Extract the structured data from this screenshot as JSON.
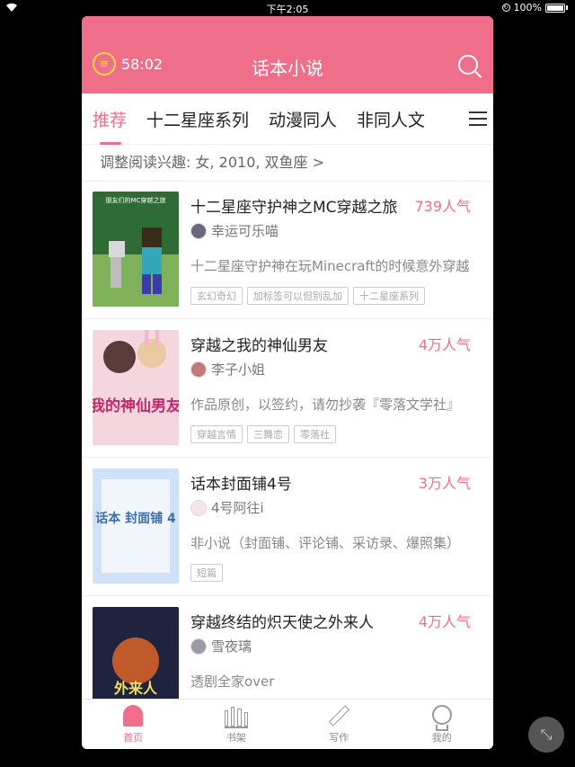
{
  "status_bar": {
    "time": "下午2:05",
    "battery": "100%"
  },
  "header": {
    "timer": "58:02",
    "title": "话本小说"
  },
  "tabs": [
    "推荐",
    "十二星座系列",
    "动漫同人",
    "非同人文"
  ],
  "interest": "调整阅读兴趣: 女, 2010, 双鱼座 >",
  "books": [
    {
      "title": "十二星座守护神之MC穿越之旅",
      "popularity": "739人气",
      "author": "幸运可乐喵",
      "desc": "十二星座守护神在玩Minecraft的时候意外穿越",
      "tags": [
        "玄幻奇幻",
        "加标签可以但别乱加",
        "十二星座系列"
      ],
      "cover_text": "朋友们的MC穿越之旅",
      "cover_colors": [
        "#2f6b35",
        "#7fb05a"
      ]
    },
    {
      "title": "穿越之我的神仙男友",
      "popularity": "4万人气",
      "author": "李子小姐",
      "desc": "作品原创，以签约，请勿抄袭『零落文学社』",
      "tags": [
        "穿越言情",
        "三舞恋",
        "零落社"
      ],
      "cover_text": "我的神仙男友",
      "cover_colors": [
        "#f5d6df",
        "#c2688a"
      ]
    },
    {
      "title": "话本封面铺4号",
      "popularity": "3万人气",
      "author": "4号阿往i",
      "desc": "非小说（封面铺、评论铺、采访录、爆照集）",
      "tags": [
        "短篇"
      ],
      "cover_text": "话本 封面铺 4",
      "cover_colors": [
        "#cfe2f7",
        "#3d6fae"
      ]
    },
    {
      "title": "穿越终结的炽天使之外来人",
      "popularity": "4万人气",
      "author": "雪夜璃",
      "desc": "透剧全家over",
      "tags": [],
      "cover_text": "外来人",
      "cover_colors": [
        "#1f2340",
        "#c05a2a"
      ]
    }
  ],
  "tabbar": [
    {
      "label": "首页",
      "icon": "home-icon"
    },
    {
      "label": "书架",
      "icon": "bookshelf-icon"
    },
    {
      "label": "写作",
      "icon": "pen-icon"
    },
    {
      "label": "我的",
      "icon": "profile-bulb-icon"
    }
  ],
  "colors": {
    "accent": "#ef6f8a"
  }
}
